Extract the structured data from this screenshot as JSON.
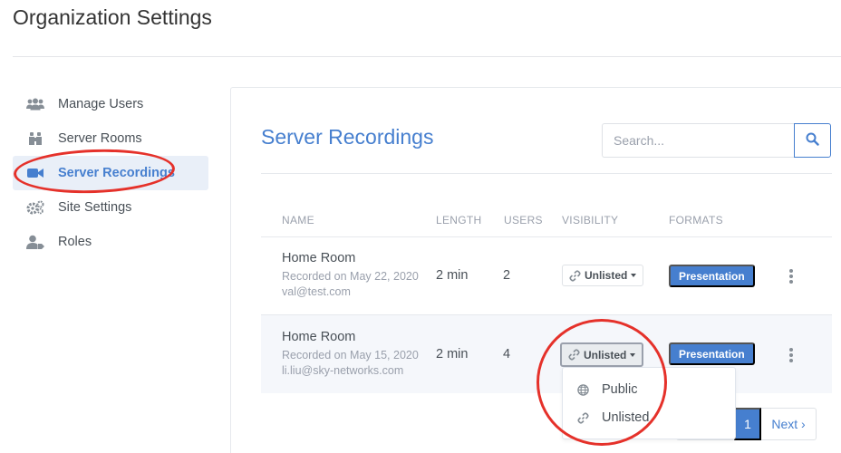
{
  "page_title": "Organization Settings",
  "sidebar": {
    "items": [
      {
        "label": "Manage Users",
        "icon": "users-icon"
      },
      {
        "label": "Server Rooms",
        "icon": "binoculars-icon"
      },
      {
        "label": "Server Recordings",
        "icon": "video-camera-icon",
        "active": true
      },
      {
        "label": "Site Settings",
        "icon": "gears-icon"
      },
      {
        "label": "Roles",
        "icon": "user-tag-icon"
      }
    ]
  },
  "main": {
    "title": "Server Recordings",
    "search": {
      "placeholder": "Search...",
      "value": ""
    },
    "columns": [
      "NAME",
      "LENGTH",
      "USERS",
      "VISIBILITY",
      "FORMATS"
    ],
    "rows": [
      {
        "name": "Home Room",
        "recorded": "Recorded on May 22, 2020",
        "email": "val@test.com",
        "length": "2 min",
        "users": "2",
        "visibility": "Unlisted",
        "format": "Presentation"
      },
      {
        "name": "Home Room",
        "recorded": "Recorded on May 15, 2020",
        "email": "li.liu@sky-networks.com",
        "length": "2 min",
        "users": "4",
        "visibility": "Unlisted",
        "format": "Presentation"
      }
    ],
    "visibility_menu": {
      "options": [
        {
          "label": "Public",
          "icon": "globe-icon"
        },
        {
          "label": "Unlisted",
          "icon": "link-icon"
        }
      ]
    },
    "pagination": {
      "current": "1",
      "next_label": "Next ›"
    }
  },
  "colors": {
    "accent": "#467fcf",
    "highlight_circle": "#e5312a"
  }
}
